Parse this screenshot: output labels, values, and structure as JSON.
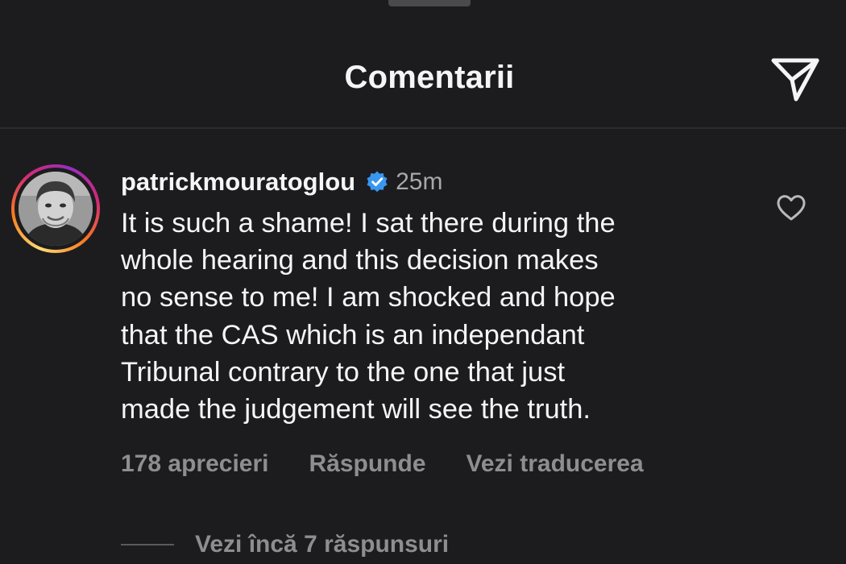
{
  "header": {
    "title": "Comentarii",
    "share_icon": "paper-plane-icon"
  },
  "comment": {
    "username": "patrickmouratoglou",
    "verified_icon": "verified-badge-icon",
    "time": "25m",
    "text_lines": [
      "It is such a shame! I sat there during the",
      "whole hearing and this decision makes",
      "no sense to me! I am shocked and hope",
      "that the CAS which is an independant",
      "Tribunal contrary to the one that just",
      "made the judgement will see the truth."
    ],
    "likes": "178 aprecieri",
    "reply_label": "Răspunde",
    "translate_label": "Vezi traducerea",
    "like_icon": "heart-outline-icon",
    "more_replies": "Vezi încă 7 răspunsuri"
  },
  "colors": {
    "background": "#1c1c1e",
    "text": "#f5f5f5",
    "muted": "#8e8e8e",
    "verified": "#3897f0"
  }
}
